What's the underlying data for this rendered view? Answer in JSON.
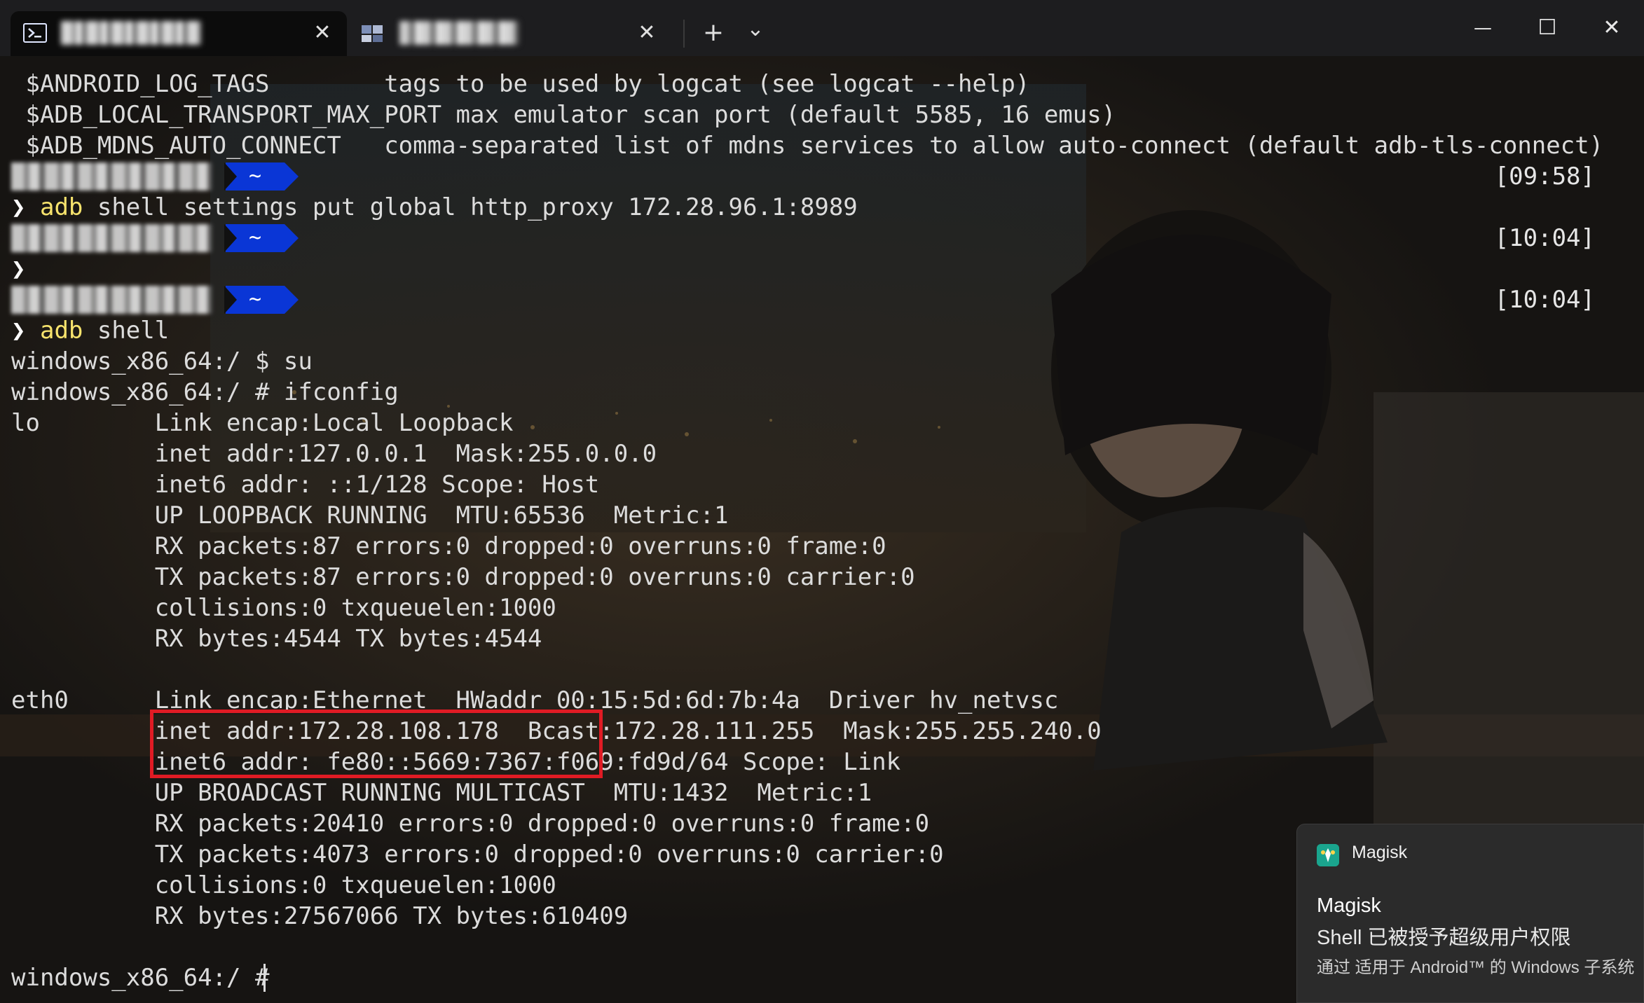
{
  "titlebar": {
    "tab1_title": "▓▓▓▓▓▓▓",
    "tab2_title": "▓▓▓▓▓▓▓",
    "close_glyph": "✕",
    "new_tab_glyph": "+",
    "dropdown_glyph": "⌄",
    "minimize_glyph": "—",
    "maximize_glyph": "☐",
    "window_close_glyph": "✕"
  },
  "terminal": {
    "lines": [
      " $ANDROID_LOG_TAGS        tags to be used by logcat (see logcat --help)",
      " $ADB_LOCAL_TRANSPORT_MAX_PORT max emulator scan port (default 5585, 16 emus)",
      " $ADB_MDNS_AUTO_CONNECT   comma-separated list of mdns services to allow auto-connect (default adb-tls-connect)"
    ],
    "prompt1": {
      "tilde": "~",
      "time": "[09:58]"
    },
    "cmd1": {
      "arrow": "❯",
      "bin": "adb",
      "args": " shell settings put global http_proxy 172.28.96.1:8989"
    },
    "prompt2": {
      "tilde": "~",
      "time": "[10:04]"
    },
    "cmd2": {
      "arrow": "❯"
    },
    "prompt3": {
      "tilde": "~",
      "time": "[10:04]"
    },
    "cmd3": {
      "arrow": "❯",
      "bin": "adb",
      "args": " shell"
    },
    "output": [
      "windows_x86_64:/ $ su",
      "windows_x86_64:/ # ifconfig",
      "lo        Link encap:Local Loopback",
      "          inet addr:127.0.0.1  Mask:255.0.0.0",
      "          inet6 addr: ::1/128 Scope: Host",
      "          UP LOOPBACK RUNNING  MTU:65536  Metric:1",
      "          RX packets:87 errors:0 dropped:0 overruns:0 frame:0",
      "          TX packets:87 errors:0 dropped:0 overruns:0 carrier:0",
      "          collisions:0 txqueuelen:1000",
      "          RX bytes:4544 TX bytes:4544",
      "",
      "eth0      Link encap:Ethernet  HWaddr 00:15:5d:6d:7b:4a  Driver hv_netvsc",
      "          inet addr:172.28.108.178  Bcast:172.28.111.255  Mask:255.255.240.0",
      "          inet6 addr: fe80::5669:7367:f069:fd9d/64 Scope: Link",
      "          UP BROADCAST RUNNING MULTICAST  MTU:1432  Metric:1",
      "          RX packets:20410 errors:0 dropped:0 overruns:0 frame:0",
      "          TX packets:4073 errors:0 dropped:0 overruns:0 carrier:0",
      "          collisions:0 txqueuelen:1000",
      "          RX bytes:27567066 TX bytes:610409",
      "",
      "windows_x86_64:/ # "
    ]
  },
  "toast": {
    "app_name": "Magisk",
    "title": "Magisk",
    "message": "Shell 已被授予超级用户权限",
    "source": "通过 适用于 Android™ 的 Windows 子系统"
  },
  "colors": {
    "prompt_segment": "#0a36d6",
    "command_highlight": "#f7e36d",
    "annotation_box": "#e01b24"
  }
}
